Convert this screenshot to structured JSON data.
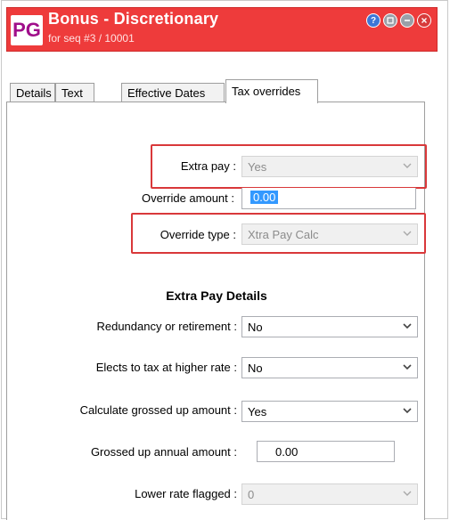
{
  "window": {
    "logo": "PG",
    "title": "Bonus - Discretionary",
    "subtitle": "for seq #3 / 10001",
    "icons": [
      "help-icon",
      "restore-icon",
      "minimize-icon",
      "close-icon"
    ]
  },
  "tabs": [
    {
      "label": "Details"
    },
    {
      "label": "Text"
    },
    {
      "label": "Effective Dates"
    },
    {
      "label": "Tax overrides",
      "active": true
    }
  ],
  "form": {
    "extra_pay": {
      "label": "Extra pay :",
      "value": "Yes",
      "disabled": true
    },
    "override_amount": {
      "label": "Override amount :",
      "value": "0.00"
    },
    "override_type": {
      "label": "Override type :",
      "value": "Xtra Pay Calc",
      "disabled": true
    },
    "section_title": "Extra Pay Details",
    "redundancy": {
      "label": "Redundancy or retirement :",
      "value": "No"
    },
    "higher_rate": {
      "label": "Elects to tax at higher rate :",
      "value": "No"
    },
    "grossed_up": {
      "label": "Calculate grossed up amount :",
      "value": "Yes"
    },
    "grossed_annual": {
      "label": "Grossed up annual amount :",
      "value": "0.00"
    },
    "lower_rate": {
      "label": "Lower rate flagged :",
      "value": "0",
      "disabled": true
    }
  },
  "colors": {
    "titlebar": "#ee3b3b",
    "logo_text": "#a00e8a",
    "highlight": "#d9383a",
    "selection": "#3399ff"
  }
}
